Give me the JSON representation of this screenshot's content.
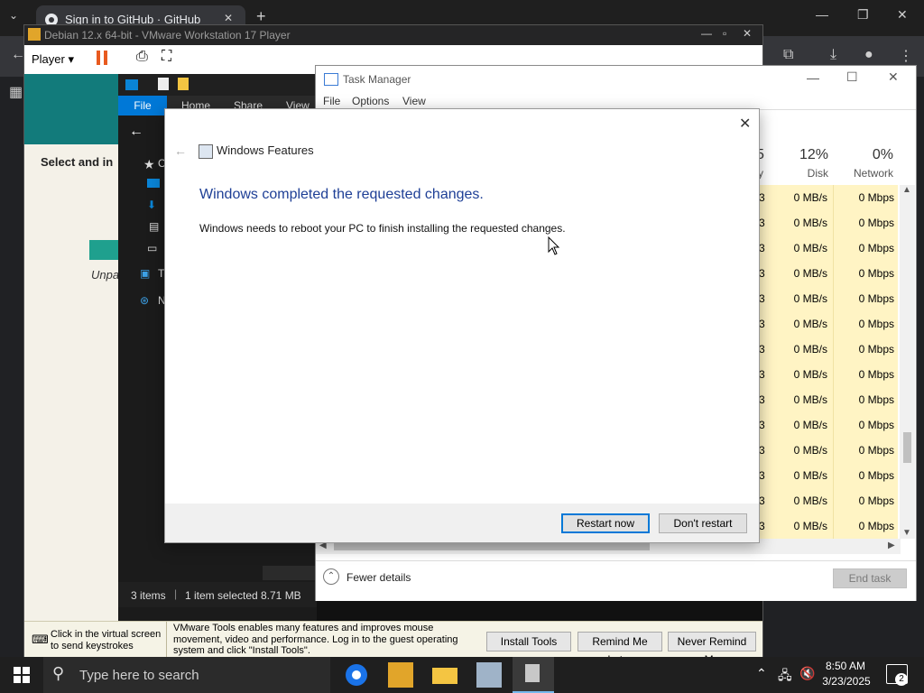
{
  "chrome": {
    "tab_title": "Sign in to GitHub · GitHub",
    "new_tab": "+",
    "tab_close": "✕"
  },
  "vmware": {
    "title": "Debian 12.x 64-bit - VMware Workstation 17 Player",
    "player_menu": "Player",
    "status": {
      "hint": "Click in the virtual screen to send keystrokes",
      "message": "VMware Tools enables many features and improves mouse movement, video and performance. Log in to the guest operating system and click \"Install Tools\".",
      "install_tools": "Install Tools",
      "remind_later": "Remind Me Later",
      "never_remind": "Never Remind Me"
    }
  },
  "guest_page": {
    "select_text": "Select and in",
    "unpa": "Unpa"
  },
  "explorer": {
    "ribbon": [
      "File",
      "Home",
      "Share",
      "View"
    ],
    "nav": [
      "C",
      "",
      "",
      "",
      "",
      "T",
      "N"
    ],
    "status_items": "3 items",
    "status_selected": "1 item selected",
    "status_size": "8.71 MB"
  },
  "task_manager": {
    "title": "Task Manager",
    "menu": [
      "File",
      "Options",
      "View"
    ],
    "cols": [
      {
        "pct": "5",
        "label": "y"
      },
      {
        "pct": "12%",
        "label": "Disk"
      },
      {
        "pct": "0%",
        "label": "Network"
      }
    ],
    "rows": [
      [
        "3",
        "0 MB/s",
        "0 Mbps"
      ],
      [
        "3",
        "0 MB/s",
        "0 Mbps"
      ],
      [
        "3",
        "0 MB/s",
        "0 Mbps"
      ],
      [
        "3",
        "0 MB/s",
        "0 Mbps"
      ],
      [
        "3",
        "0 MB/s",
        "0 Mbps"
      ],
      [
        "3",
        "0 MB/s",
        "0 Mbps"
      ],
      [
        "3",
        "0 MB/s",
        "0 Mbps"
      ],
      [
        "3",
        "0 MB/s",
        "0 Mbps"
      ],
      [
        "3",
        "0 MB/s",
        "0 Mbps"
      ],
      [
        "3",
        "0 MB/s",
        "0 Mbps"
      ],
      [
        "3",
        "0 MB/s",
        "0 Mbps"
      ],
      [
        "3",
        "0 MB/s",
        "0 Mbps"
      ],
      [
        "3",
        "0 MB/s",
        "0 Mbps"
      ],
      [
        "3",
        "0 MB/s",
        "0 Mbps"
      ]
    ],
    "fewer_details": "Fewer details",
    "end_task": "End task"
  },
  "dialog": {
    "header": "Windows Features",
    "heading": "Windows completed the requested changes.",
    "body": "Windows needs to reboot your PC to finish installing the requested changes.",
    "restart": "Restart now",
    "dont_restart": "Don't restart",
    "close": "✕"
  },
  "taskbar": {
    "search_placeholder": "Type here to search",
    "time": "8:50 AM",
    "date": "3/23/2025",
    "notif_count": "2"
  },
  "colors": {
    "accent": "#0078d7",
    "heading_blue": "#1e3f96",
    "tm_highlight": "#fff4c4"
  }
}
